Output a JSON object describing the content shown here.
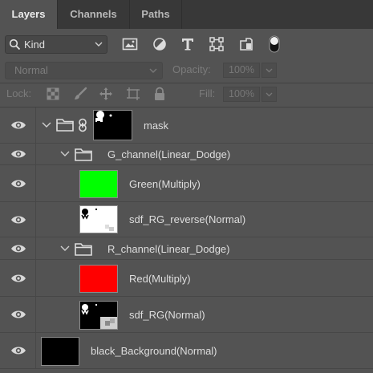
{
  "panel": {
    "tabs": [
      {
        "label": "Layers",
        "active": true
      },
      {
        "label": "Channels",
        "active": false
      },
      {
        "label": "Paths",
        "active": false
      }
    ]
  },
  "filter": {
    "kind_label": "Kind",
    "icons": [
      "image-filter-icon",
      "adjustment-filter-icon",
      "type-filter-icon",
      "shape-filter-icon",
      "smart-object-filter-icon",
      "filter-toggle-icon"
    ]
  },
  "blend": {
    "mode": "Normal",
    "opacity_label": "Opacity:",
    "opacity_value": "100%",
    "fill_label": "Fill:",
    "fill_value": "100%"
  },
  "lock": {
    "label": "Lock:",
    "icons": [
      "lock-transparent-pixels-icon",
      "lock-image-pixels-icon",
      "lock-position-icon",
      "lock-artboard-icon",
      "lock-all-icon"
    ]
  },
  "layers": [
    {
      "name": "mask",
      "type": "group",
      "thumb": "mask",
      "linked": true,
      "visible": true
    },
    {
      "name": "G_channel(Linear_Dodge)",
      "type": "group",
      "visible": true
    },
    {
      "name": "Green(Multiply)",
      "type": "fill",
      "thumb_color": "#00ff00",
      "visible": true
    },
    {
      "name": "sdf_RG_reverse(Normal)",
      "type": "pixel",
      "thumb": "sdf_reverse",
      "visible": true
    },
    {
      "name": "R_channel(Linear_Dodge)",
      "type": "group",
      "visible": true
    },
    {
      "name": "Red(Multiply)",
      "type": "fill",
      "thumb_color": "#ff0000",
      "visible": true
    },
    {
      "name": "sdf_RG(Normal)",
      "type": "pixel",
      "thumb": "sdf",
      "visible": true
    },
    {
      "name": "black_Background(Normal)",
      "type": "fill",
      "thumb_color": "#000000",
      "visible": true
    }
  ]
}
